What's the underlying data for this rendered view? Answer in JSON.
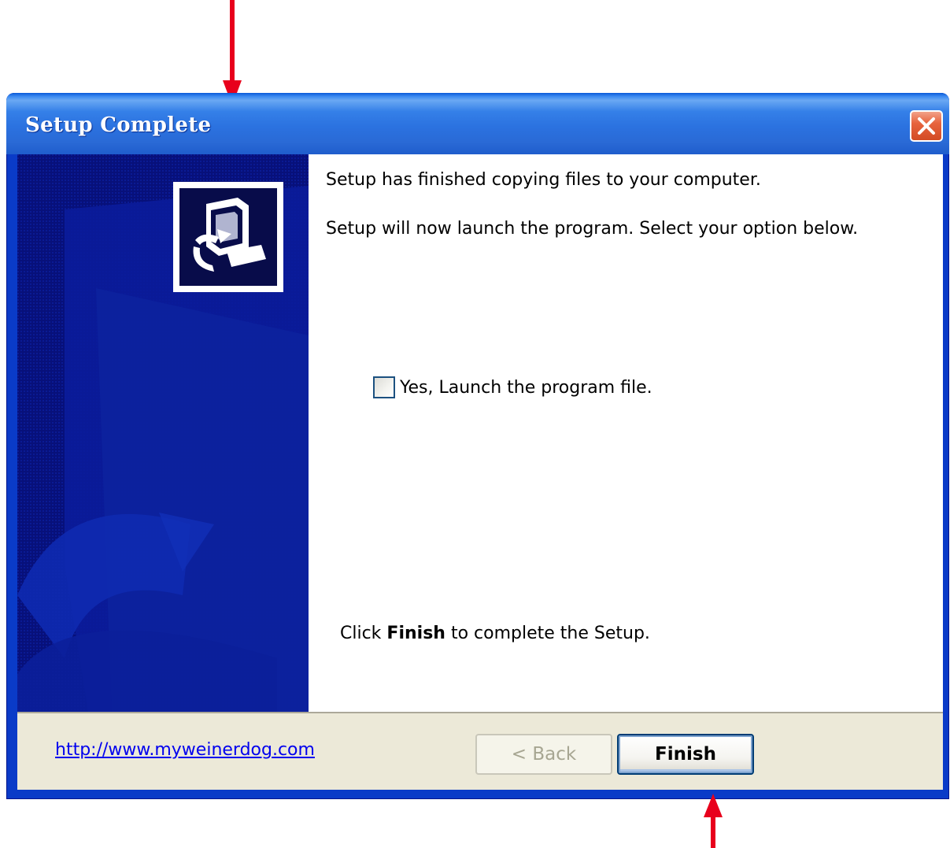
{
  "window": {
    "title": "Setup Complete"
  },
  "content": {
    "line1": "Setup has finished copying files to your computer.",
    "line2": "Setup will now launch the program. Select your option below.",
    "launch_checkbox": {
      "label": "Yes, Launch the program file.",
      "checked": false
    },
    "finish_prefix": "Click ",
    "finish_bold": "Finish",
    "finish_suffix": " to complete the Setup."
  },
  "footer": {
    "link_text": "http://www.myweinerdog.com",
    "back_label": "< Back",
    "finish_label": "Finish"
  },
  "icons": {
    "close": "close-icon",
    "setup": "setup-computer-icon",
    "annotation": "red-arrow-icon"
  },
  "colors": {
    "annotation_arrow": "#e8001c",
    "banner": "#07107a",
    "link": "#0000ee"
  }
}
